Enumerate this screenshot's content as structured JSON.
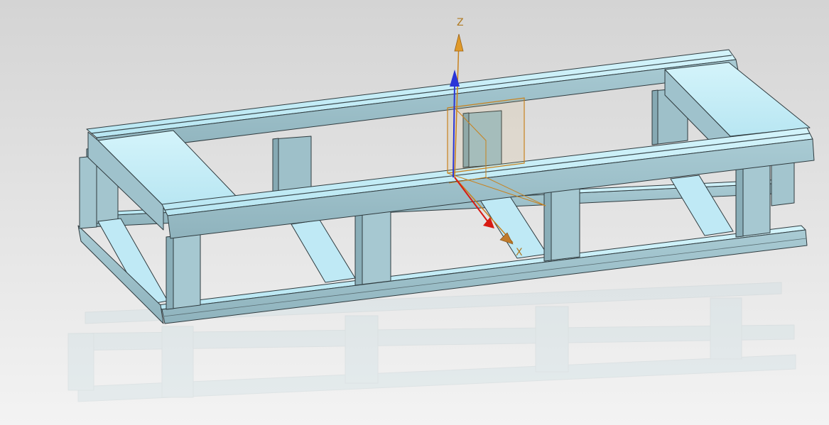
{
  "viewport": {
    "background_top": "#d4d4d4",
    "background_bottom": "#f3f3f3",
    "model": "rectangular-tube-frame",
    "reflection_visible": true
  },
  "colors": {
    "frame_top_face": "#c6eef8",
    "frame_side_face": "#9fc2cc",
    "frame_dark_face": "#86a9b3",
    "frame_edge": "#2f3b3f",
    "csys_color": "#c8821e",
    "axis_z_color": "#2a35d8",
    "axis_x_color": "#d81a12"
  },
  "triad": {
    "z_label": "Z",
    "x_label": "X",
    "z_icon": "z-axis-arrow-icon",
    "x_icon": "x-axis-arrow-icon",
    "plane_icon": "datum-plane-icon"
  }
}
